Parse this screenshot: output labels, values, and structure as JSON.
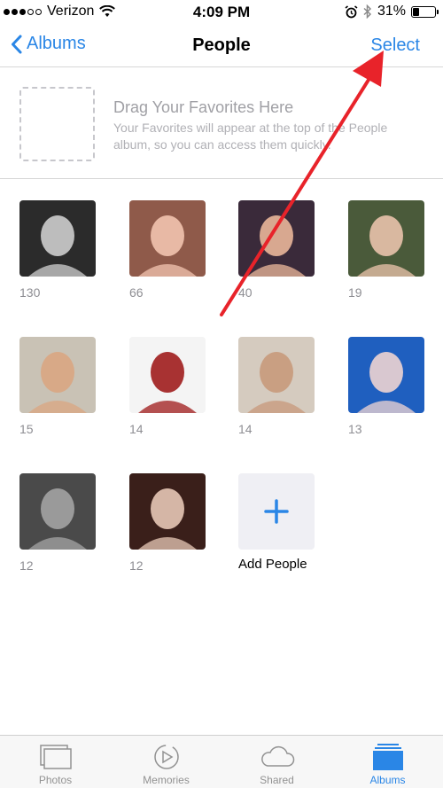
{
  "status_bar": {
    "carrier": "Verizon",
    "time": "4:09 PM",
    "battery_percent": "31%",
    "battery_level": 0.31,
    "icons": [
      "signal-dots",
      "wifi-icon",
      "alarm-icon",
      "bluetooth-icon",
      "battery-icon"
    ]
  },
  "nav": {
    "back_label": "Albums",
    "title": "People",
    "select_label": "Select"
  },
  "favorites": {
    "title": "Drag Your Favorites Here",
    "description": "Your Favorites will appear at the top of the People album, so you can access them quickly."
  },
  "people": [
    {
      "count": "130",
      "colors": [
        "#2b2b2b",
        "#bdbdbd"
      ]
    },
    {
      "count": "66",
      "colors": [
        "#8f5a4a",
        "#e8b9a5"
      ]
    },
    {
      "count": "40",
      "colors": [
        "#3a2a3a",
        "#d8a890"
      ]
    },
    {
      "count": "19",
      "colors": [
        "#4a5a3a",
        "#d9b8a0"
      ]
    },
    {
      "count": "15",
      "colors": [
        "#c9c2b5",
        "#d8a987"
      ]
    },
    {
      "count": "14",
      "colors": [
        "#f4f4f4",
        "#a83232"
      ]
    },
    {
      "count": "14",
      "colors": [
        "#d5cbbf",
        "#c99f82"
      ]
    },
    {
      "count": "13",
      "colors": [
        "#1f5fbf",
        "#d9c8d0"
      ]
    },
    {
      "count": "12",
      "colors": [
        "#4a4a4a",
        "#9a9a9a"
      ]
    },
    {
      "count": "12",
      "colors": [
        "#3a1f1a",
        "#d5b6a6"
      ]
    }
  ],
  "add_people": {
    "label": "Add People",
    "plus": "+"
  },
  "tabs": [
    {
      "label": "Photos",
      "icon": "photos-icon",
      "active": false
    },
    {
      "label": "Memories",
      "icon": "memories-icon",
      "active": false
    },
    {
      "label": "Shared",
      "icon": "cloud-icon",
      "active": false
    },
    {
      "label": "Albums",
      "icon": "albums-icon",
      "active": true
    }
  ],
  "colors": {
    "accent": "#2a86e6",
    "arrow": "#e8232a",
    "placeholder_text": "#a0a0a5"
  }
}
